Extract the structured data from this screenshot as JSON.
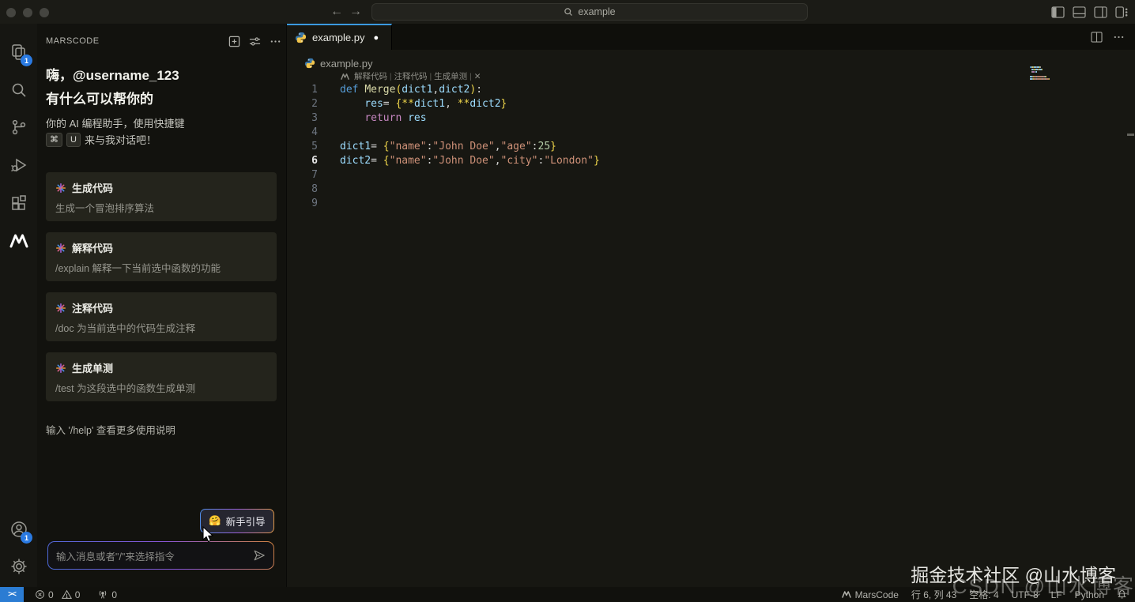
{
  "titlebar": {
    "search_value": "example",
    "nav_back": "←",
    "nav_forward": "→"
  },
  "activity_bar": {
    "explorer_badge": "1",
    "account_badge": "1"
  },
  "sidebar": {
    "title": "MARSCODE",
    "greeting_line1": "嗨，@username_123",
    "greeting_line2": "有什么可以帮你的",
    "assistant_hint_line1": "你的 AI 编程助手，使用快捷键",
    "shortcut_key1": "⌘",
    "shortcut_key2": "U",
    "assistant_hint_line2": "来与我对话吧！",
    "cards": [
      {
        "title": "生成代码",
        "desc": "生成一个冒泡排序算法"
      },
      {
        "title": "解释代码",
        "desc": "/explain 解释一下当前选中函数的功能"
      },
      {
        "title": "注释代码",
        "desc": "/doc 为当前选中的代码生成注释"
      },
      {
        "title": "生成单测",
        "desc": "/test 为这段选中的函数生成单测"
      }
    ],
    "help_hint": "输入 '/help' 查看更多使用说明",
    "guide_button": {
      "emoji": "🤗",
      "label": "新手引导"
    },
    "input_placeholder": "输入消息或者\"/\"来选择指令"
  },
  "editor": {
    "tab": {
      "filename": "example.py",
      "modified": "●"
    },
    "breadcrumb": "example.py",
    "codelens": {
      "items": [
        "解释代码",
        "注释代码",
        "生成单测"
      ],
      "separator": "|",
      "close": "✕"
    },
    "code": {
      "language": "python",
      "lines": [
        {
          "num": "1",
          "tokens": [
            [
              "def ",
              "kw"
            ],
            [
              "Merge",
              "fn"
            ],
            [
              "(",
              "br"
            ],
            [
              "dict1",
              "var"
            ],
            [
              ",",
              "pun"
            ],
            [
              "dict2",
              "var"
            ],
            [
              ")",
              "br"
            ],
            [
              ":",
              "pun"
            ]
          ]
        },
        {
          "num": "2",
          "tokens": [
            [
              "    res",
              "var"
            ],
            [
              "= ",
              "pun"
            ],
            [
              "{",
              "br"
            ],
            [
              "**",
              "op"
            ],
            [
              "dict1",
              "var"
            ],
            [
              ", ",
              "pun"
            ],
            [
              "**",
              "op"
            ],
            [
              "dict2",
              "var"
            ],
            [
              "}",
              "br"
            ]
          ]
        },
        {
          "num": "3",
          "tokens": [
            [
              "    ",
              "pun"
            ],
            [
              "return",
              "ctrl"
            ],
            [
              " res",
              "var"
            ]
          ]
        },
        {
          "num": "4",
          "tokens": []
        },
        {
          "num": "5",
          "tokens": [
            [
              "dict1",
              "var"
            ],
            [
              "= ",
              "pun"
            ],
            [
              "{",
              "br"
            ],
            [
              "\"name\"",
              "str"
            ],
            [
              ":",
              "pun"
            ],
            [
              "\"John Doe\"",
              "str"
            ],
            [
              ",",
              "pun"
            ],
            [
              "\"age\"",
              "str"
            ],
            [
              ":",
              "pun"
            ],
            [
              "25",
              "num"
            ],
            [
              "}",
              "br"
            ]
          ]
        },
        {
          "num": "6",
          "active": true,
          "tokens": [
            [
              "dict2",
              "var"
            ],
            [
              "= ",
              "pun"
            ],
            [
              "{",
              "br"
            ],
            [
              "\"name\"",
              "str"
            ],
            [
              ":",
              "pun"
            ],
            [
              "\"John Doe\"",
              "str"
            ],
            [
              ",",
              "pun"
            ],
            [
              "\"city\"",
              "str"
            ],
            [
              ":",
              "pun"
            ],
            [
              "\"London\"",
              "str"
            ],
            [
              "}",
              "br"
            ]
          ]
        },
        {
          "num": "7",
          "tokens": []
        },
        {
          "num": "8",
          "tokens": []
        },
        {
          "num": "9",
          "tokens": []
        }
      ]
    }
  },
  "status_bar": {
    "errors": "0",
    "warnings": "0",
    "ports": "0",
    "marscode": "MarsCode",
    "cursor_position": "行 6, 列 43",
    "indent": "空格: 4",
    "encoding": "UTF-8",
    "eol": "LF",
    "language": "Python"
  },
  "watermarks": {
    "front": "掘金技术社区 @山水博客",
    "back": "CSDN @山水博客"
  },
  "colors": {
    "accent_blue": "#3b99e0",
    "badge_blue": "#2a7ae2",
    "remote_blue": "#2b7cd3"
  }
}
